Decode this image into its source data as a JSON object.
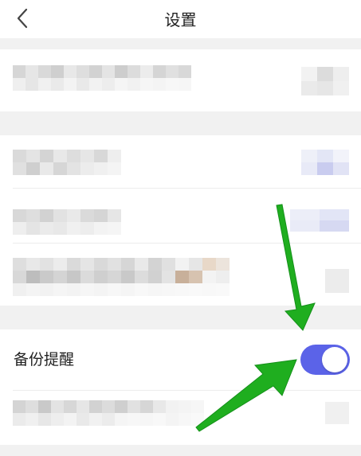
{
  "nav": {
    "title": "设置",
    "back_icon": "chevron-left-icon"
  },
  "settings": {
    "backup_reminder": {
      "label": "备份提醒",
      "enabled": true
    }
  },
  "colors": {
    "toggle_on": "#5b63e8",
    "annotation_arrow": "#1fae1f",
    "section_gap": "#f1f1f1"
  },
  "annotation": {
    "arrows_icon": "green-arrow-icon"
  }
}
